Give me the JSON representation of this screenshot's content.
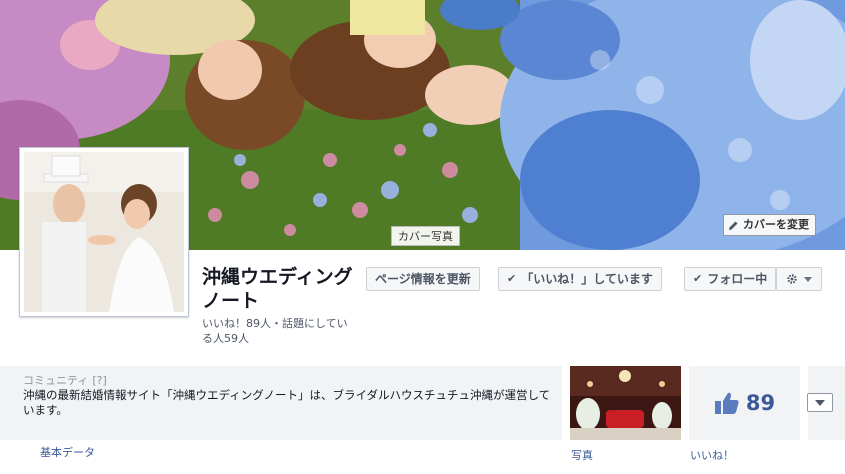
{
  "cover": {
    "hover_label": "カバー写真",
    "change_cover_label": "カバーを変更"
  },
  "page": {
    "name": "沖縄ウエディングノート",
    "stats": "いいね！89人・話題にしている人59人"
  },
  "actions": {
    "update_info": "ページ情報を更新",
    "liked": "「いいね！」しています",
    "following": "フォロー中"
  },
  "about": {
    "category": "コミュニティ",
    "help": "[?]",
    "description": "沖縄の最新結婚情報サイト「沖縄ウエディングノート」は、ブライダルハウスチュチュ沖縄が運営しています。",
    "tab_label": "基本データ"
  },
  "photos": {
    "tab_label": "写真"
  },
  "likes": {
    "count": "89",
    "tab_label": "いいね！"
  },
  "icons": {
    "pencil": "pencil-icon",
    "check": "check-icon",
    "gear": "gear-icon",
    "thumbs_up": "thumbs-up-icon",
    "chevron_down": "chevron-down-icon"
  },
  "colors": {
    "link": "#3b5998",
    "panel": "#f2f3f5",
    "button_bg": "#f6f7f9"
  }
}
